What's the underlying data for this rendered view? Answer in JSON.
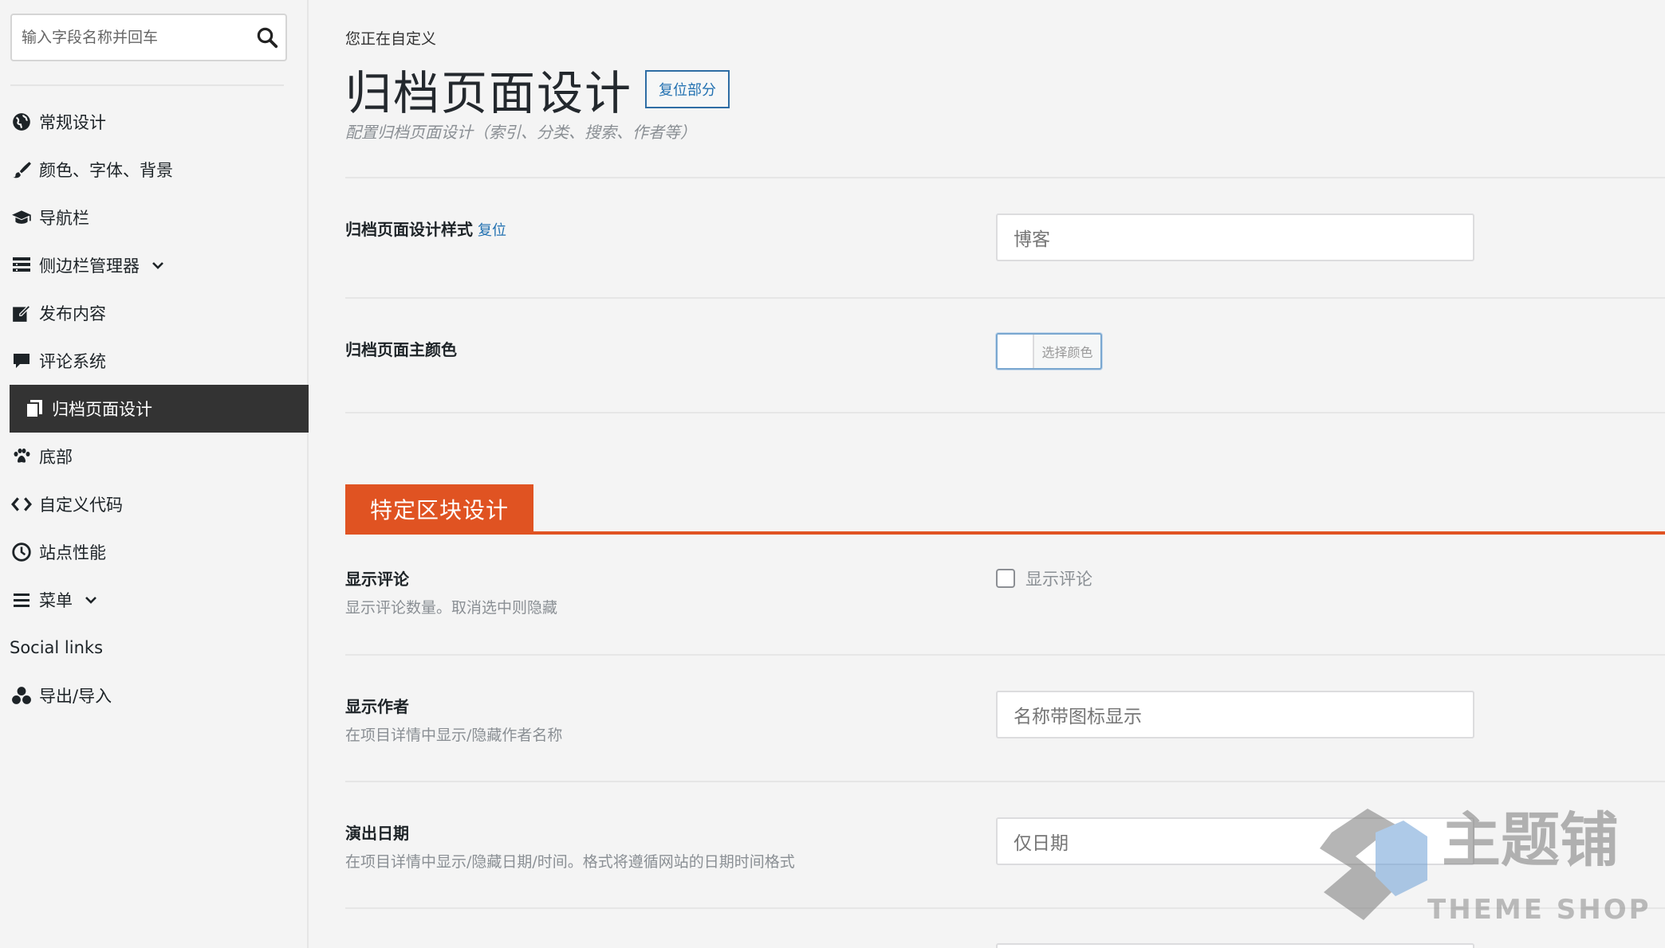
{
  "sidebar": {
    "search_placeholder": "输入字段名称并回车",
    "items": [
      {
        "label": "常规设计",
        "icon": "globe-icon"
      },
      {
        "label": "颜色、字体、背景",
        "icon": "paintbrush-icon"
      },
      {
        "label": "导航栏",
        "icon": "graduation-cap-icon"
      },
      {
        "label": "侧边栏管理器",
        "icon": "list-icon",
        "expandable": true
      },
      {
        "label": "发布内容",
        "icon": "edit-icon"
      },
      {
        "label": "评论系统",
        "icon": "comment-icon"
      },
      {
        "label": "归档页面设计",
        "icon": "copy-icon",
        "active": true
      },
      {
        "label": "底部",
        "icon": "paw-icon"
      },
      {
        "label": "自定义代码",
        "icon": "code-icon"
      },
      {
        "label": "站点性能",
        "icon": "clock-icon"
      },
      {
        "label": "菜单",
        "icon": "menu-icon",
        "expandable": true
      },
      {
        "label": "Social links",
        "icon": ""
      },
      {
        "label": "导出/导入",
        "icon": "share-icon"
      }
    ]
  },
  "main": {
    "eyebrow": "您正在自定义",
    "title": "归档页面设计",
    "reset_section_label": "复位部分",
    "description": "配置归档页面设计（索引、分类、搜索、作者等）",
    "fields": {
      "archive_style": {
        "label": "归档页面设计样式",
        "reset_label": "复位",
        "value": "博客"
      },
      "archive_color": {
        "label": "归档页面主颜色",
        "picker_label": "选择颜色",
        "value": "#ffffff"
      },
      "show_comments": {
        "label": "显示评论",
        "description": "显示评论数量。取消选中则隐藏",
        "checkbox_label": "显示评论",
        "checked": false
      },
      "show_author": {
        "label": "显示作者",
        "description": "在项目详情中显示/隐藏作者名称",
        "value": "名称带图标显示"
      },
      "show_date": {
        "label": "演出日期",
        "description": "在项目详情中显示/隐藏日期/时间。格式将遵循网站的日期时间格式",
        "value": "仅日期"
      }
    },
    "section_heading": "特定区块设计"
  },
  "watermark": {
    "cn": "主题铺",
    "en": "THEME SHOP"
  },
  "colors": {
    "accent": "#e05322",
    "active_bg": "#333333",
    "link": "#2271b1"
  }
}
